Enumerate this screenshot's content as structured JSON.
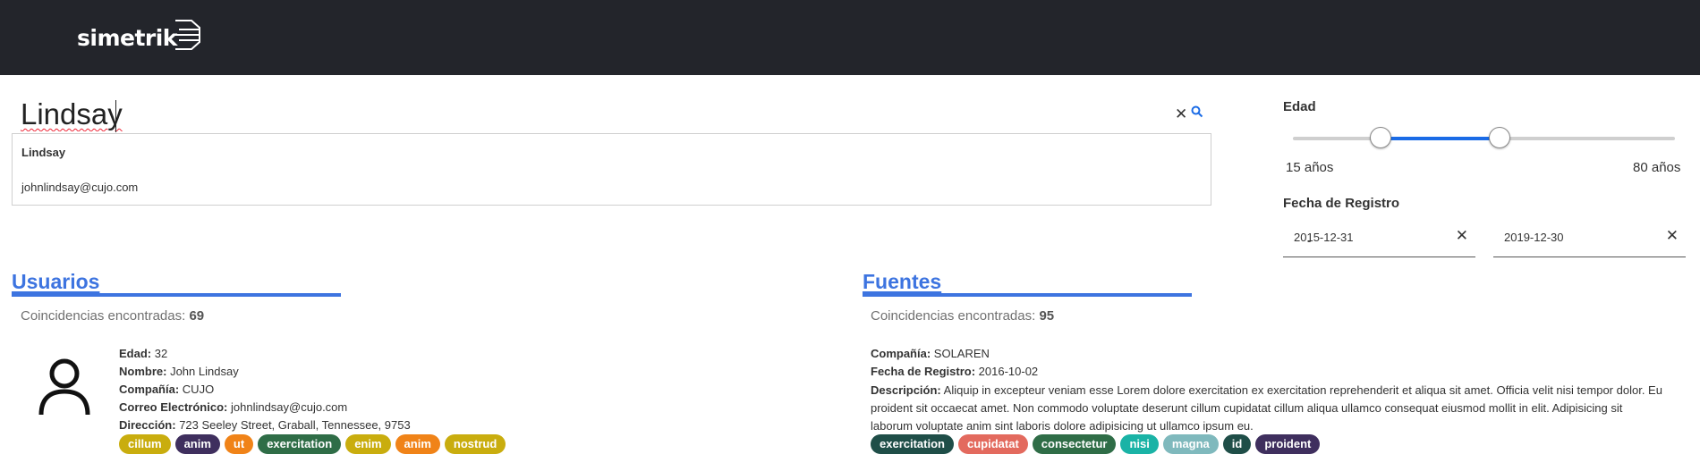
{
  "header": {
    "logo_text": "simetrik"
  },
  "search": {
    "value": "Lindsay",
    "suggestions": [
      {
        "text": "Lindsay"
      },
      {
        "text": "johnlindsay@cujo.com"
      }
    ]
  },
  "filters": {
    "age": {
      "title": "Edad",
      "min_label": "15 años",
      "max_label": "80 años",
      "low_fraction": 0.23,
      "high_fraction": 0.54
    },
    "date": {
      "title": "Fecha de Registro",
      "from": "2015-12-31",
      "to": "2019-12-30",
      "separator": "-"
    }
  },
  "users": {
    "title": "Usuarios",
    "count_label": "Coincidencias encontradas:",
    "count": "69",
    "card": {
      "fields": [
        {
          "key": "Edad:",
          "value": "32"
        },
        {
          "key": "Nombre:",
          "value": "John Lindsay"
        },
        {
          "key": "Compañía:",
          "value": "CUJO"
        },
        {
          "key": "Correo Electrónico:",
          "value": "johnlindsay@cujo.com"
        },
        {
          "key": "Dirección:",
          "value": "723 Seeley Street, Graball, Tennessee, 9753"
        }
      ],
      "tags": [
        {
          "label": "cillum",
          "color": "#c9ad0e"
        },
        {
          "label": "anim",
          "color": "#3f2f5e"
        },
        {
          "label": "ut",
          "color": "#f08318"
        },
        {
          "label": "exercitation",
          "color": "#2f6d47"
        },
        {
          "label": "enim",
          "color": "#c9ad0e"
        },
        {
          "label": "anim",
          "color": "#f08318"
        },
        {
          "label": "nostrud",
          "color": "#c9ad0e"
        }
      ]
    }
  },
  "sources": {
    "title": "Fuentes",
    "count_label": "Coincidencias encontradas:",
    "count": "95",
    "card": {
      "company_key": "Compañía:",
      "company": "SOLAREN",
      "date_key": "Fecha de Registro:",
      "date": "2016-10-02",
      "desc_key": "Descripción:",
      "desc": "Aliquip in excepteur veniam esse Lorem dolore exercitation ex exercitation reprehenderit et aliqua sit amet. Officia velit nisi tempor dolor. Eu proident sit occaecat amet. Non commodo voluptate deserunt cillum cupidatat cillum aliqua ullamco consequat eiusmod mollit in elit. Adipisicing sit laborum voluptate anim sint laboris dolore adipisicing ut ullamco ipsum eu.",
      "tags": [
        {
          "label": "exercitation",
          "color": "#1f4e48"
        },
        {
          "label": "cupidatat",
          "color": "#e36a5e"
        },
        {
          "label": "consectetur",
          "color": "#2f6d47"
        },
        {
          "label": "nisi",
          "color": "#1ab3a6"
        },
        {
          "label": "magna",
          "color": "#7fb9bd"
        },
        {
          "label": "id",
          "color": "#1f4e48"
        },
        {
          "label": "proident",
          "color": "#3f2f5e"
        }
      ]
    }
  }
}
